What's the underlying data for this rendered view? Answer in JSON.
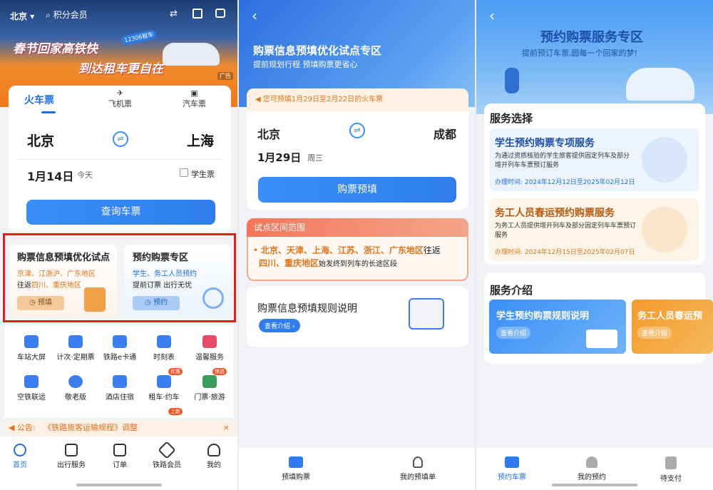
{
  "screen1": {
    "city": "北京",
    "member": "积分会员",
    "banner": {
      "line1": "春节回家高铁快",
      "line2": "到达租车更自在",
      "tag": "12306租车",
      "ad": "广告"
    },
    "tabs": [
      {
        "label": "火车票"
      },
      {
        "label": "飞机票"
      },
      {
        "label": "汽车票"
      }
    ],
    "from": "北京",
    "to": "上海",
    "date": "1月14日",
    "day": "今天",
    "student": "学生票",
    "search": "查询车票",
    "promo1": {
      "title": "购票信息预填优化试点",
      "line1": "京津、江浙沪、广东地区",
      "line2a": "往返",
      "line2b": "四川、重庆地区",
      "btn": "预填"
    },
    "promo2": {
      "title": "预约购票专区",
      "line1": "学生、务工人员预约",
      "line2": "提前订票 出行无忧",
      "btn": "预约"
    },
    "grid": [
      {
        "label": "车站大屏",
        "color": "#3a7ef0"
      },
      {
        "label": "计次·定期票",
        "color": "#3a7ef0"
      },
      {
        "label": "铁路e卡通",
        "color": "#3a7ef0"
      },
      {
        "label": "时刻表",
        "color": "#3a7ef0"
      },
      {
        "label": "温馨服务",
        "color": "#e84a6a"
      },
      {
        "label": "空铁联运",
        "color": "#3a7ef0"
      },
      {
        "label": "敬老版",
        "color": "#3a7ef0"
      },
      {
        "label": "酒店住宿",
        "color": "#3a7ef0"
      },
      {
        "label": "租车·约车",
        "color": "#3a7ef0"
      },
      {
        "label": "门票·旅游",
        "color": "#3a9e5a"
      }
    ],
    "badge1": "优惠",
    "badge2": "惊选",
    "badge3": "上新",
    "notice": {
      "label": "公告:",
      "text": "《铁路旅客运输规程》调整",
      "close": "×"
    },
    "nav": [
      {
        "label": "首页"
      },
      {
        "label": "出行服务"
      },
      {
        "label": "订单"
      },
      {
        "label": "铁路会员"
      },
      {
        "label": "我的"
      }
    ]
  },
  "screen2": {
    "back": "‹",
    "title": "购票信息预填优化试点专区",
    "subtitle": "提前规划行程 预填购票更省心",
    "hint": "您可预填1月29日至2月22日的火车票",
    "from": "北京",
    "to": "成都",
    "date": "1月29日",
    "weekday": "周三",
    "btn": "购票预填",
    "range": {
      "title": "试点区间范围",
      "regions": "北京、天津、上海、江苏、浙江、广东地区",
      "t1": "往返",
      "regions2": "四川、重庆地区",
      "t2": "始发终到列车的长途区段"
    },
    "rules": {
      "title": "购票信息预填规则说明",
      "btn": "查看介绍 ›"
    },
    "nav": [
      {
        "label": "预填购票"
      },
      {
        "label": "我的预填单"
      }
    ]
  },
  "screen3": {
    "back": "‹",
    "title": "预约购票服务专区",
    "subtitle": "提前预订车票,圆每一个回家的梦!",
    "section1": "服务选择",
    "svc1": {
      "title": "学生预约购票专项服务",
      "desc": "为通过资质核验的学生旅客提供固定列车及部分增开列车车票预订服务",
      "time": "办理时间: 2024年12月12日至2025年02月12日"
    },
    "svc2": {
      "title": "务工人员春运预约购票服务",
      "desc": "为务工人员提供增开列车及部分固定列车车票预订服务",
      "time": "办理时间: 2024年12月15日至2025年02月07日"
    },
    "section2": "服务介绍",
    "intro1": {
      "title": "学生预约购票规则说明",
      "btn": "查看介绍"
    },
    "intro2": {
      "title": "务工人员春运预",
      "btn": "查看介绍"
    },
    "nav": [
      {
        "label": "预约车票"
      },
      {
        "label": "我的预约"
      },
      {
        "label": "待支付"
      }
    ]
  }
}
